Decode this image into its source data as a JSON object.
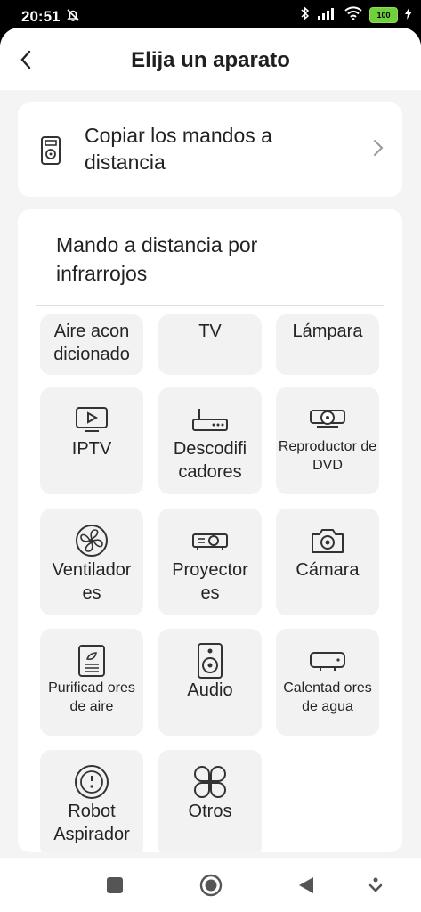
{
  "status": {
    "time": "20:51",
    "battery": "100"
  },
  "header": {
    "title": "Elija un aparato"
  },
  "copy_card": {
    "label": "Copiar los mandos a distancia"
  },
  "ir_section": {
    "title": "Mando a distancia por infrarrojos",
    "devices": [
      {
        "label": "Aire acon dicionado",
        "icon": "air-conditioner-icon"
      },
      {
        "label": "TV",
        "icon": "tv-icon"
      },
      {
        "label": "Lámpara",
        "icon": "lamp-icon"
      },
      {
        "label": "IPTV",
        "icon": "iptv-icon"
      },
      {
        "label": "Descodifi cadores",
        "icon": "decoder-icon"
      },
      {
        "label": "Reproductor de DVD",
        "icon": "dvd-player-icon"
      },
      {
        "label": "Ventilador es",
        "icon": "fan-icon"
      },
      {
        "label": "Proyector es",
        "icon": "projector-icon"
      },
      {
        "label": "Cámara",
        "icon": "camera-icon"
      },
      {
        "label": "Purificad ores de aire",
        "icon": "air-purifier-icon"
      },
      {
        "label": "Audio",
        "icon": "speaker-icon"
      },
      {
        "label": "Calentad ores de agua",
        "icon": "water-heater-icon"
      },
      {
        "label": "Robot Aspirador",
        "icon": "robot-vacuum-icon"
      },
      {
        "label": "Otros",
        "icon": "others-icon"
      }
    ]
  },
  "colors": {
    "background": "#f4f4f4",
    "card": "#ffffff",
    "tile": "#f2f2f2",
    "battery": "#6fd13e"
  }
}
